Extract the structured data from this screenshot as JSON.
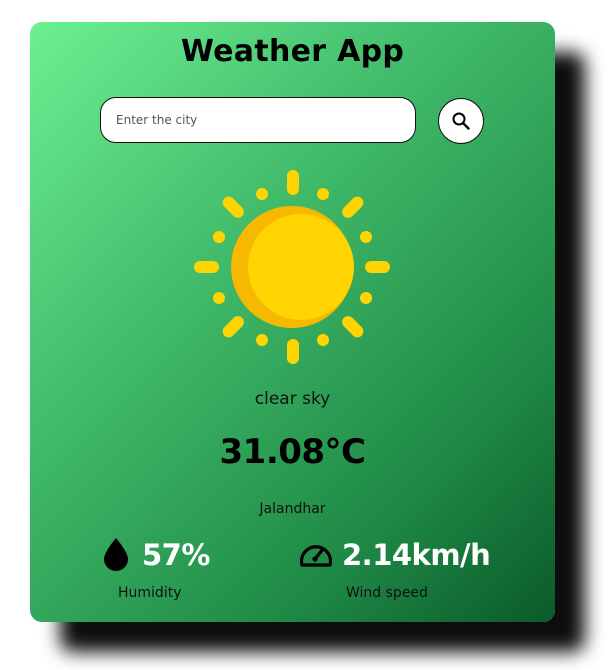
{
  "app": {
    "title": "Weather App"
  },
  "search": {
    "placeholder": "Enter the city",
    "value": "",
    "button_icon": "search-icon"
  },
  "weather": {
    "icon": "sun-icon",
    "description": "clear sky",
    "temperature": "31.08°C",
    "city": "Jalandhar"
  },
  "details": {
    "humidity": {
      "icon": "humidity-drop-icon",
      "value": "57%",
      "label": "Humidity"
    },
    "wind": {
      "icon": "speedometer-icon",
      "value": "2.14km/h",
      "label": "Wind speed"
    }
  },
  "colors": {
    "card_gradient_start": "#6cf092",
    "card_gradient_end": "#0b5a2a",
    "sun": "#ffd400",
    "sun_shade": "#f7b900",
    "stat_value": "#ffffff"
  }
}
